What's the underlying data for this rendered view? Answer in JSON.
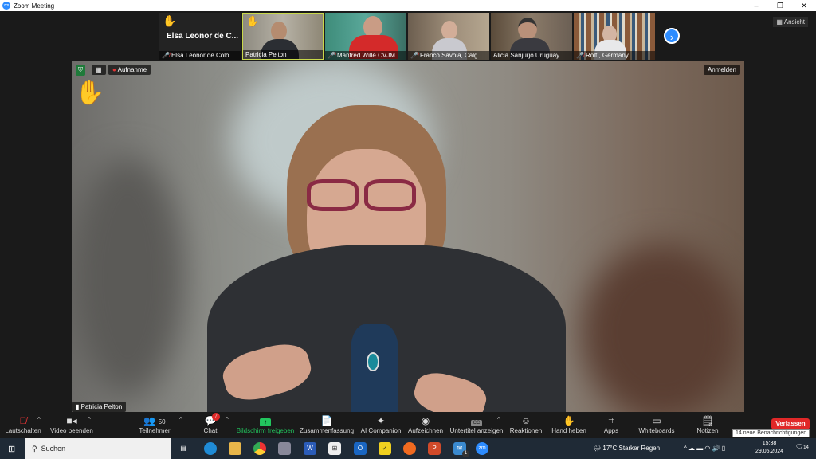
{
  "window": {
    "title": "Zoom Meeting",
    "app_icon": "zm"
  },
  "view_button": "Ansicht",
  "thumbnails": [
    {
      "name": "Elsa Leonor de Colo...",
      "big_name": "Elsa Leonor de C...",
      "muted": true,
      "hand": true,
      "video": false
    },
    {
      "name": "Patricia Pelton",
      "muted": false,
      "hand": true,
      "video": true,
      "active": true
    },
    {
      "name": "Manfred Wille CVJM ...",
      "muted": true,
      "video": true
    },
    {
      "name": "Franco Savoia, Calgar...",
      "muted": true,
      "video": true
    },
    {
      "name": "Alicia Sanjurjo Uruguay",
      "muted": false,
      "video": true
    },
    {
      "name": "Rolf , Germany",
      "muted": true,
      "video": true
    }
  ],
  "main_video": {
    "speaker": "Patricia Pelton",
    "recording_label": "Aufnahme",
    "signin_label": "Anmelden"
  },
  "toolbar": {
    "mute": "Lautschalten",
    "video": "Video beenden",
    "participants": "Teilnehmer",
    "participants_count": "50",
    "chat": "Chat",
    "chat_badge": "7",
    "share": "Bildschirm freigeben",
    "summary": "Zusammenfassung",
    "ai": "AI Companion",
    "record": "Aufzeichnen",
    "cc": "Untertitel anzeigen",
    "cc_icon": "CC",
    "reactions": "Reaktionen",
    "hand": "Hand heben",
    "apps": "Apps",
    "whiteboards": "Whiteboards",
    "notes": "Notizen",
    "leave": "Verlassen",
    "notifications_tooltip": "14 neue Benachrichtigungen"
  },
  "taskbar": {
    "search": "Suchen",
    "weather": "17°C  Starker Regen",
    "time": "15:38",
    "date": "29.05.2024",
    "notif_count": "14",
    "mail_badge": "1"
  },
  "colors": {
    "accent": "#2d8cff",
    "leave": "#e02828",
    "share": "#22c55e"
  }
}
